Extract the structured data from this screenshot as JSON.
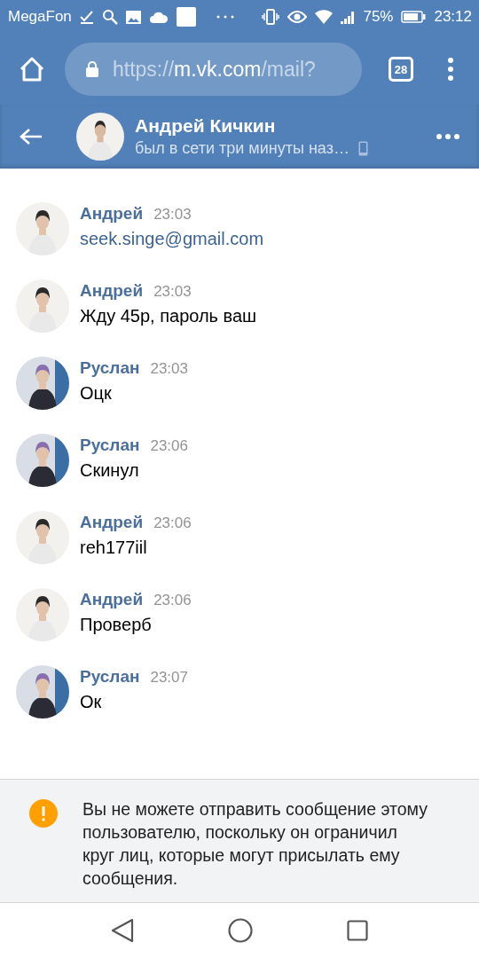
{
  "status_bar": {
    "carrier": "MegaFon",
    "battery": "75%",
    "time": "23:12"
  },
  "browser": {
    "url": {
      "scheme": "https://",
      "host": "m.vk.com",
      "path": "/mail?"
    },
    "tab_count": "28"
  },
  "chat_header": {
    "name": "Андрей Кичкин",
    "status": "был в сети три минуты наз…"
  },
  "messages": [
    {
      "sender": "Андрей",
      "color": "#f3f1ee",
      "time": "23:03",
      "text": "seek.singe@gmail.com",
      "link": true
    },
    {
      "sender": "Андрей",
      "color": "#f3f1ee",
      "time": "23:03",
      "text": "Жду 45р, пароль ваш",
      "link": false
    },
    {
      "sender": "Руслан",
      "color": "#3b6ea5",
      "time": "23:03",
      "text": "Оцк",
      "link": false
    },
    {
      "sender": "Руслан",
      "color": "#3b6ea5",
      "time": "23:06",
      "text": "Скинул",
      "link": false
    },
    {
      "sender": "Андрей",
      "color": "#f3f1ee",
      "time": "23:06",
      "text": "reh177iil",
      "link": false
    },
    {
      "sender": "Андрей",
      "color": "#f3f1ee",
      "time": "23:06",
      "text": "Проверб",
      "link": false
    },
    {
      "sender": "Руслан",
      "color": "#3b6ea5",
      "time": "23:07",
      "text": "Ок",
      "link": false
    }
  ],
  "notice": {
    "text": "Вы не можете отправить сообщение этому пользователю, поскольку он ограничил круг лиц, которые могут присылать ему сообщения."
  }
}
